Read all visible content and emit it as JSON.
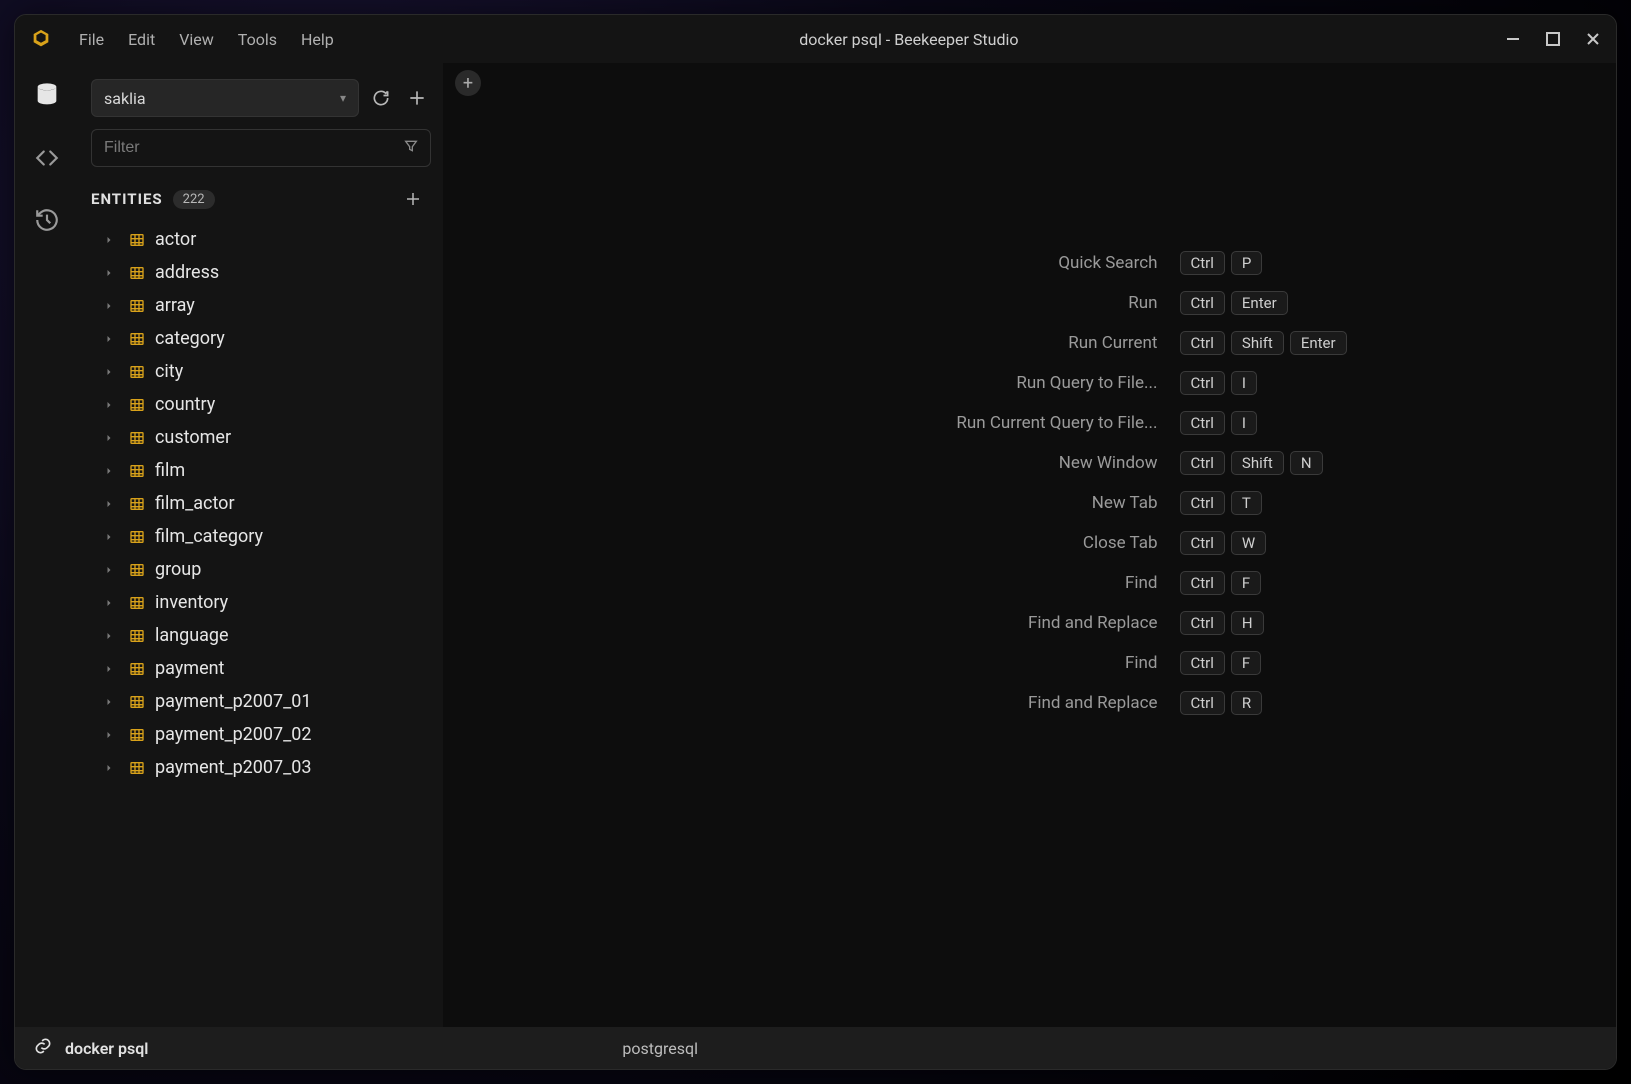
{
  "window": {
    "title": "docker psql - Beekeeper Studio"
  },
  "menu": {
    "items": [
      "File",
      "Edit",
      "View",
      "Tools",
      "Help"
    ]
  },
  "sidebar": {
    "database_selected": "saklia",
    "filter_placeholder": "Filter",
    "entities_label": "ENTITIES",
    "entities_count": "222",
    "tables": [
      "actor",
      "address",
      "array",
      "category",
      "city",
      "country",
      "customer",
      "film",
      "film_actor",
      "film_category",
      "group",
      "inventory",
      "language",
      "payment",
      "payment_p2007_01",
      "payment_p2007_02",
      "payment_p2007_03"
    ]
  },
  "shortcuts": [
    {
      "label": "Quick Search",
      "keys": [
        "Ctrl",
        "P"
      ]
    },
    {
      "label": "Run",
      "keys": [
        "Ctrl",
        "Enter"
      ]
    },
    {
      "label": "Run Current",
      "keys": [
        "Ctrl",
        "Shift",
        "Enter"
      ]
    },
    {
      "label": "Run Query to File...",
      "keys": [
        "Ctrl",
        "I"
      ]
    },
    {
      "label": "Run Current Query to File...",
      "keys": [
        "Ctrl",
        "I"
      ]
    },
    {
      "label": "New Window",
      "keys": [
        "Ctrl",
        "Shift",
        "N"
      ]
    },
    {
      "label": "New Tab",
      "keys": [
        "Ctrl",
        "T"
      ]
    },
    {
      "label": "Close Tab",
      "keys": [
        "Ctrl",
        "W"
      ]
    },
    {
      "label": "Find",
      "keys": [
        "Ctrl",
        "F"
      ]
    },
    {
      "label": "Find and Replace",
      "keys": [
        "Ctrl",
        "H"
      ]
    },
    {
      "label": "Find",
      "keys": [
        "Ctrl",
        "F"
      ]
    },
    {
      "label": "Find and Replace",
      "keys": [
        "Ctrl",
        "R"
      ]
    }
  ],
  "statusbar": {
    "connection": "docker psql",
    "driver": "postgresql"
  }
}
